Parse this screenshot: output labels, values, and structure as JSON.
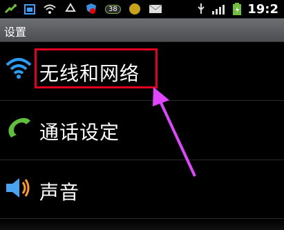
{
  "status_bar": {
    "time": "19:2",
    "badge_count": "38",
    "icons_left": [
      "usb-debug-icon",
      "calendar-icon",
      "wifi-icon",
      "sync-icon",
      "security-shield-icon"
    ],
    "icons_right": [
      "email-icon",
      "usb-icon",
      "signal-icon",
      "battery-icon"
    ]
  },
  "title_bar": {
    "title": "设置"
  },
  "settings_list": {
    "items": [
      {
        "label": "无线和网络",
        "icon": "wifi-icon",
        "highlighted": true
      },
      {
        "label": "通话设定",
        "icon": "phone-icon",
        "highlighted": false
      },
      {
        "label": "声音",
        "icon": "speaker-icon",
        "highlighted": false
      }
    ]
  },
  "colors": {
    "annotation_box": "#e1001f",
    "annotation_arrow": "#e046ff",
    "title_bar_top": "#6d6f72",
    "title_bar_bottom": "#4c4e51"
  }
}
